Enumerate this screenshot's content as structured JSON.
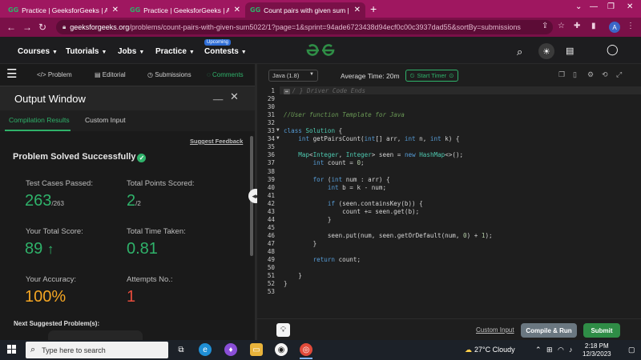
{
  "browser": {
    "tabs": [
      {
        "title": "Practice | GeeksforGeeks | A com",
        "active": false
      },
      {
        "title": "Practice | GeeksforGeeks | A com",
        "active": false
      },
      {
        "title": "Count pairs with given sum | Pra",
        "active": true
      }
    ],
    "favicon_text": "GG",
    "url_host": "geeksforgeeks.org",
    "url_path": "/problems/count-pairs-with-given-sum5022/1?page=1&sprint=94ade6723438d94ecf0c00c3937dad55&sortBy=submissions",
    "profile_initial": "A"
  },
  "site": {
    "nav": [
      {
        "label": "Courses"
      },
      {
        "label": "Tutorials"
      },
      {
        "label": "Jobs"
      },
      {
        "label": "Practice"
      },
      {
        "label": "Contests"
      }
    ],
    "upcoming_badge": "Upcoming",
    "brand_color": "#2f8d46"
  },
  "problem_tabs": [
    {
      "label": "Problem",
      "icon": "code-icon"
    },
    {
      "label": "Editorial",
      "icon": "document-icon"
    },
    {
      "label": "Submissions",
      "icon": "clock-icon"
    },
    {
      "label": "Comments",
      "icon": "comment-icon",
      "active": true
    }
  ],
  "output": {
    "title": "Output Window",
    "subtabs": [
      {
        "label": "Compilation Results",
        "active": true
      },
      {
        "label": "Custom Input",
        "active": false
      }
    ],
    "suggest_feedback": "Suggest Feedback",
    "status": "Problem Solved Successfully",
    "stats": {
      "test_cases_label": "Test Cases Passed:",
      "test_cases_value": "263",
      "test_cases_total": "/263",
      "points_label": "Total Points Scored:",
      "points_value": "2",
      "points_total": "/2",
      "score_label": "Your Total Score:",
      "score_value": "89",
      "time_label": "Total Time Taken:",
      "time_value": "0.81",
      "accuracy_label": "Your Accuracy:",
      "accuracy_value": "100%",
      "attempts_label": "Attempts No.:",
      "attempts_value": "1"
    },
    "next_label": "Next Suggested Problem(s):"
  },
  "editor": {
    "language": "Java (1.8)",
    "avg_time": "Average Time: 20m",
    "start_timer": "Start Timer",
    "lines": [
      {
        "n": "1",
        "text": "/ } Driver Code Ends"
      },
      {
        "n": "29",
        "text": ""
      },
      {
        "n": "30",
        "text": ""
      },
      {
        "n": "31",
        "text": "//User function Template for Java"
      },
      {
        "n": "32",
        "text": ""
      },
      {
        "n": "33",
        "text": "class Solution {"
      },
      {
        "n": "34",
        "text": "    int getPairsCount(int[] arr, int n, int k) {"
      },
      {
        "n": "35",
        "text": ""
      },
      {
        "n": "36",
        "text": "    Map<Integer, Integer> seen = new HashMap<>();"
      },
      {
        "n": "37",
        "text": "        int count = 0;"
      },
      {
        "n": "38",
        "text": ""
      },
      {
        "n": "39",
        "text": "        for (int num : arr) {"
      },
      {
        "n": "40",
        "text": "            int b = k - num;"
      },
      {
        "n": "41",
        "text": ""
      },
      {
        "n": "42",
        "text": "            if (seen.containsKey(b)) {"
      },
      {
        "n": "43",
        "text": "                count += seen.get(b);"
      },
      {
        "n": "44",
        "text": "            }"
      },
      {
        "n": "45",
        "text": ""
      },
      {
        "n": "46",
        "text": "            seen.put(num, seen.getOrDefault(num, 0) + 1);"
      },
      {
        "n": "47",
        "text": "        }"
      },
      {
        "n": "48",
        "text": ""
      },
      {
        "n": "49",
        "text": "        return count;"
      },
      {
        "n": "50",
        "text": ""
      },
      {
        "n": "51",
        "text": "    }"
      },
      {
        "n": "52",
        "text": "}"
      },
      {
        "n": "53",
        "text": ""
      }
    ]
  },
  "actions": {
    "custom_input": "Custom Input",
    "compile_run": "Compile & Run",
    "submit": "Submit"
  },
  "taskbar": {
    "search_placeholder": "Type here to search",
    "weather": "27°C  Cloudy",
    "time": "2:18 PM",
    "date": "12/3/2023"
  }
}
